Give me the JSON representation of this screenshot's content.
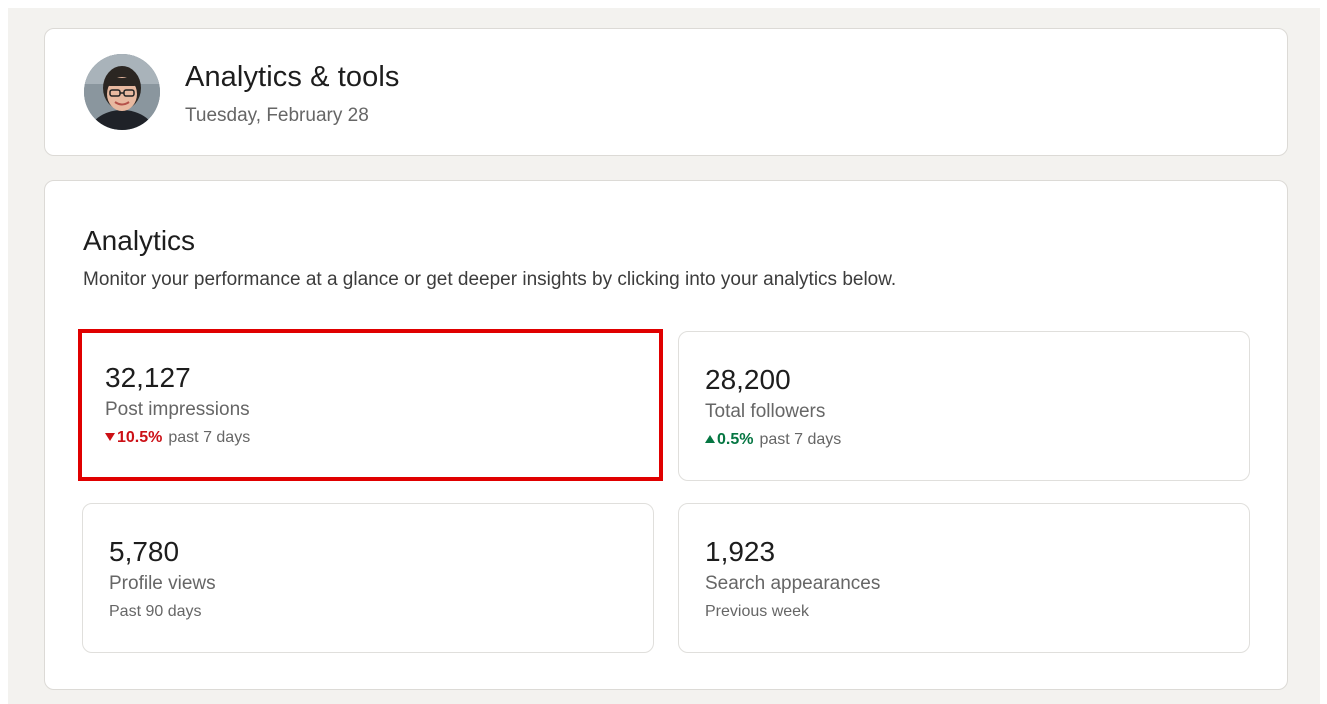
{
  "header": {
    "title": "Analytics & tools",
    "date": "Tuesday, February 28",
    "avatar_icon": "profile-photo"
  },
  "analytics": {
    "title": "Analytics",
    "subtitle": "Monitor your performance at a glance or get deeper insights by clicking into your analytics below.",
    "metrics": [
      {
        "value": "32,127",
        "label": "Post impressions",
        "trend_direction": "down",
        "trend_value": "10.5%",
        "period": "past 7 days",
        "highlighted": true
      },
      {
        "value": "28,200",
        "label": "Total followers",
        "trend_direction": "up",
        "trend_value": "0.5%",
        "period": "past 7 days",
        "highlighted": false
      },
      {
        "value": "5,780",
        "label": "Profile views",
        "period": "Past 90 days",
        "highlighted": false
      },
      {
        "value": "1,923",
        "label": "Search appearances",
        "period": "Previous week",
        "highlighted": false
      }
    ]
  },
  "colors": {
    "page_background": "#f3f2ef",
    "trend_down": "#cc1016",
    "trend_up": "#057642",
    "highlight_border": "#e00000"
  }
}
